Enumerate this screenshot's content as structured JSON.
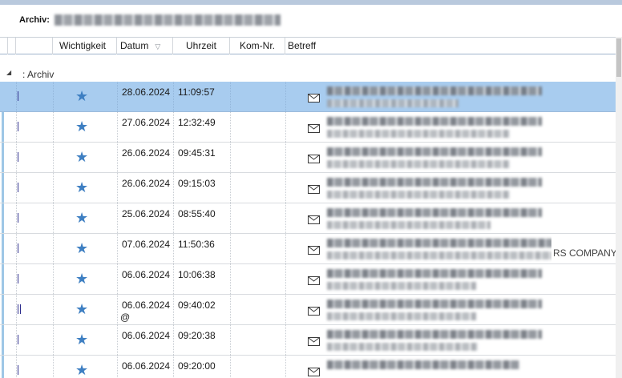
{
  "header": {
    "archiv_label": "Archiv:"
  },
  "columns": {
    "wichtigkeit": "Wichtigkeit",
    "datum": "Datum",
    "uhrzeit": "Uhrzeit",
    "kom_nr": "Kom-Nr.",
    "betreff": "Betreff"
  },
  "group": {
    "toggle_icon": "expanded-triangle-icon",
    "label": ": Archiv"
  },
  "colors": {
    "selection": "#a8ccef",
    "star": "#3e7fc2",
    "flag_strip": "#9ec7e6"
  },
  "rows": [
    {
      "date": "28.06.2024",
      "time": "11:09:57",
      "markers": 1,
      "selected": true
    },
    {
      "date": "27.06.2024",
      "time": "12:32:49",
      "markers": 1
    },
    {
      "date": "26.06.2024",
      "time": "09:45:31",
      "markers": 1
    },
    {
      "date": "26.06.2024",
      "time": "09:15:03",
      "markers": 1
    },
    {
      "date": "25.06.2024",
      "time": "08:55:40",
      "markers": 1
    },
    {
      "date": "07.06.2024",
      "time": "11:50:36",
      "markers": 1,
      "subject_suffix": "RS COMPANY"
    },
    {
      "date": "06.06.2024",
      "time": "10:06:38",
      "markers": 1
    },
    {
      "date": "06.06.2024",
      "time": "09:40:02",
      "markers": 2,
      "extra": "@"
    },
    {
      "date": "06.06.2024",
      "time": "09:20:38",
      "markers": 1
    },
    {
      "date": "06.06.2024",
      "time": "09:20:00",
      "markers": 1
    }
  ]
}
